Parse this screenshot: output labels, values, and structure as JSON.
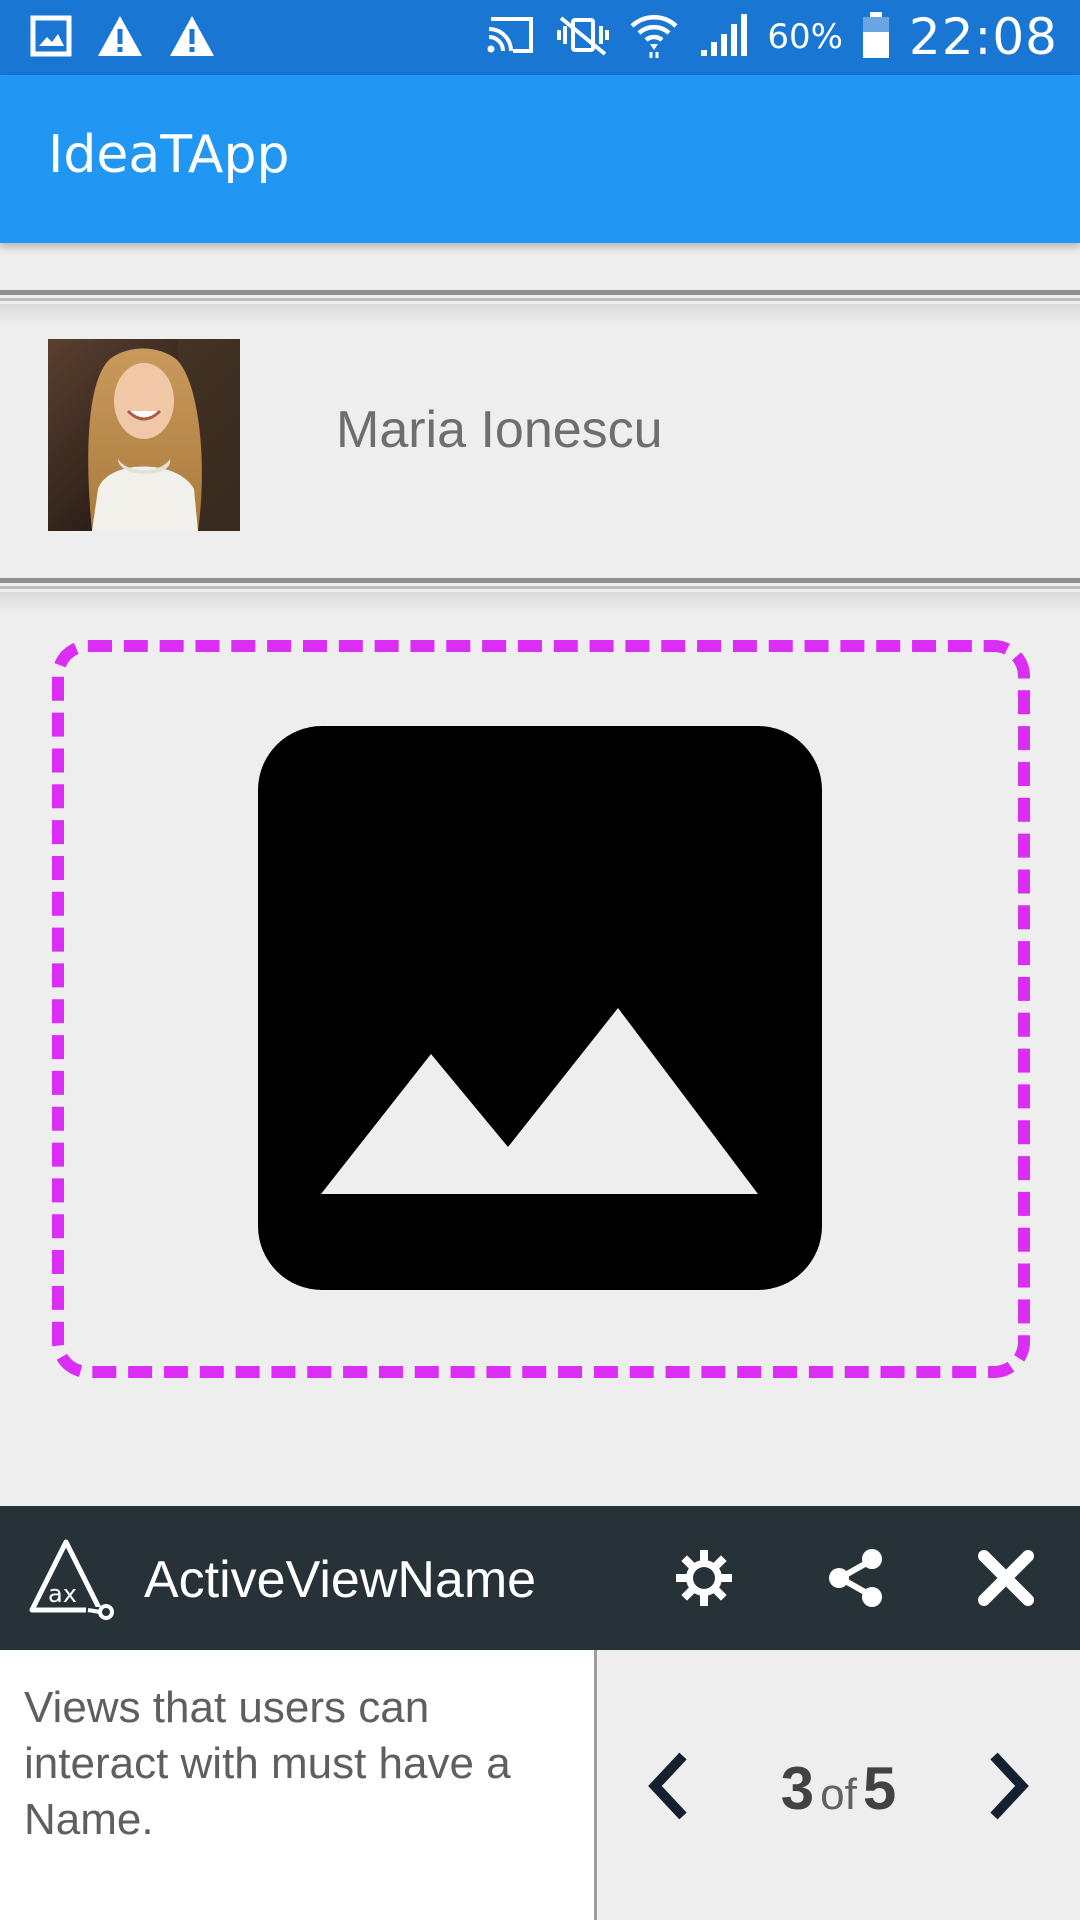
{
  "status_bar": {
    "left_icons": [
      "gallery-notification-icon",
      "warning-icon",
      "warning-icon"
    ],
    "right_icons": [
      "cast-icon",
      "vibrate-mute-icon",
      "wifi-icon",
      "signal-icon",
      "battery-icon"
    ],
    "battery": "60%",
    "time": "22:08"
  },
  "app_bar": {
    "title": "IdeaTApp",
    "color": "#2196F3"
  },
  "profile": {
    "name": "Maria Ionescu"
  },
  "highlight": {
    "color": "#DA2EF5",
    "icon": "image-placeholder-icon"
  },
  "scanner": {
    "title": "ActiveViewName",
    "message": "Views that users can interact with must have a Name.",
    "current": "3",
    "of_label": "of",
    "total": "5",
    "icons": [
      "accessibility-scanner-logo",
      "settings-icon",
      "share-icon",
      "close-icon",
      "chevron-left-icon",
      "chevron-right-icon"
    ]
  }
}
